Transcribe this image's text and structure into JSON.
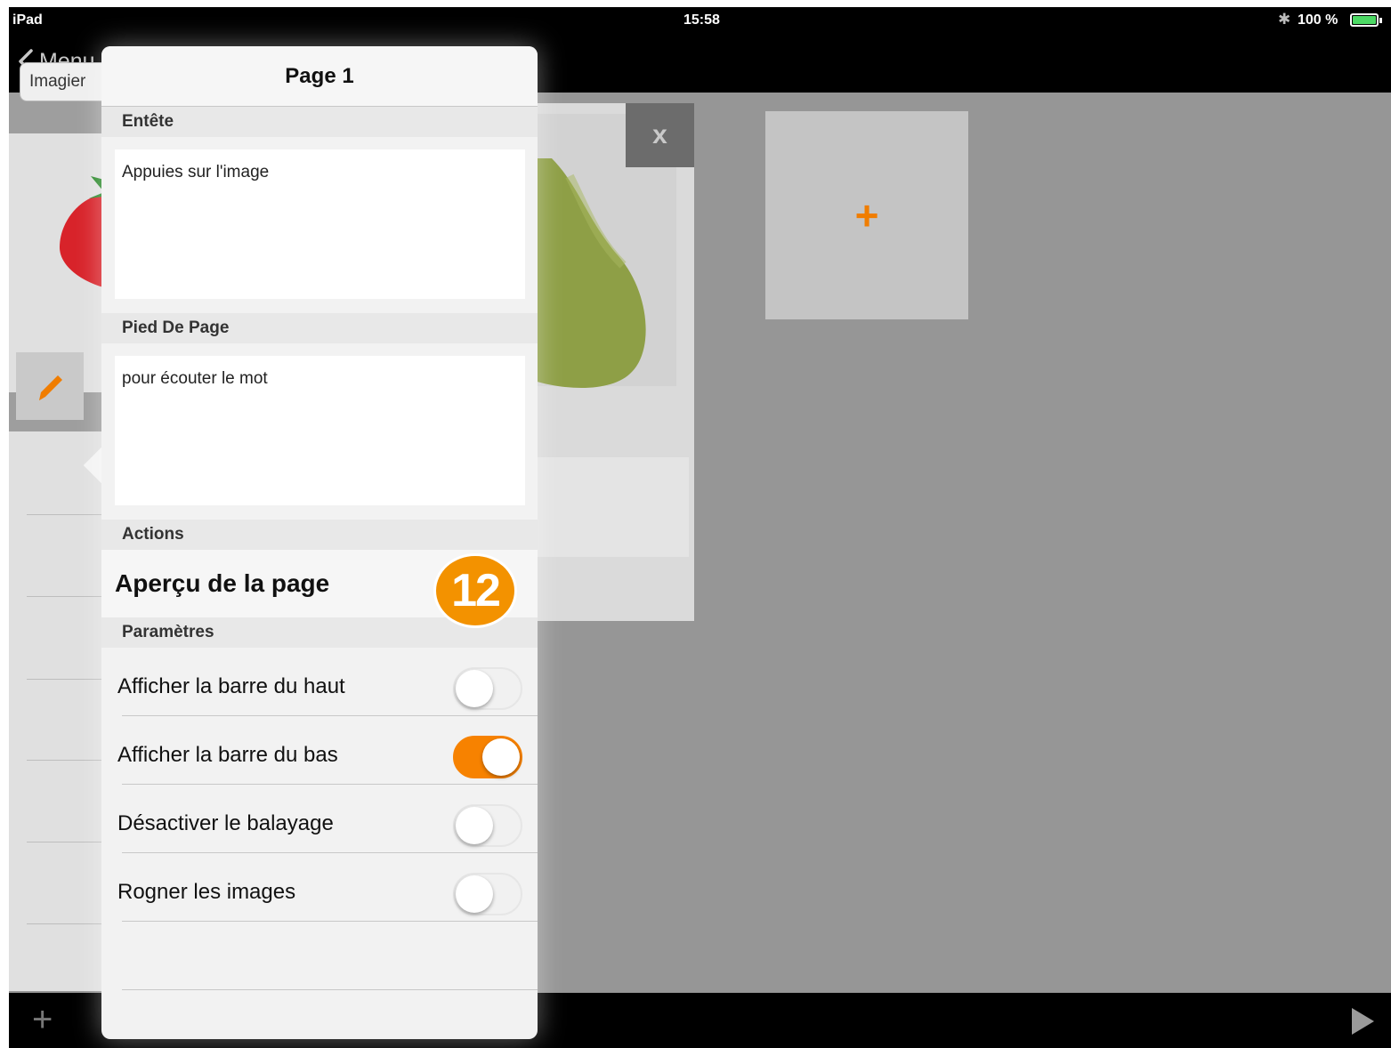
{
  "status_bar": {
    "device": "iPad",
    "time": "15:58",
    "battery": "100 %"
  },
  "nav": {
    "back_label": "Menu"
  },
  "background": {
    "select_label": "Imagier",
    "close_label": "x",
    "add_label": "+"
  },
  "popover": {
    "title": "Page 1",
    "header_section": "Entête",
    "header_text": "Appuies sur l'image",
    "footer_section": "Pied De Page",
    "footer_text": "pour écouter le mot",
    "actions_section": "Actions",
    "preview_label": "Aperçu de la page",
    "badge": "12",
    "settings_section": "Paramètres",
    "settings": [
      {
        "label": "Afficher la barre du haut",
        "on": false
      },
      {
        "label": "Afficher la barre du bas",
        "on": true
      },
      {
        "label": "Désactiver le balayage",
        "on": false
      },
      {
        "label": "Rogner les images",
        "on": false
      }
    ]
  },
  "colors": {
    "accent": "#f39200",
    "toggle_on": "#f78200",
    "battery": "#4cd964"
  }
}
